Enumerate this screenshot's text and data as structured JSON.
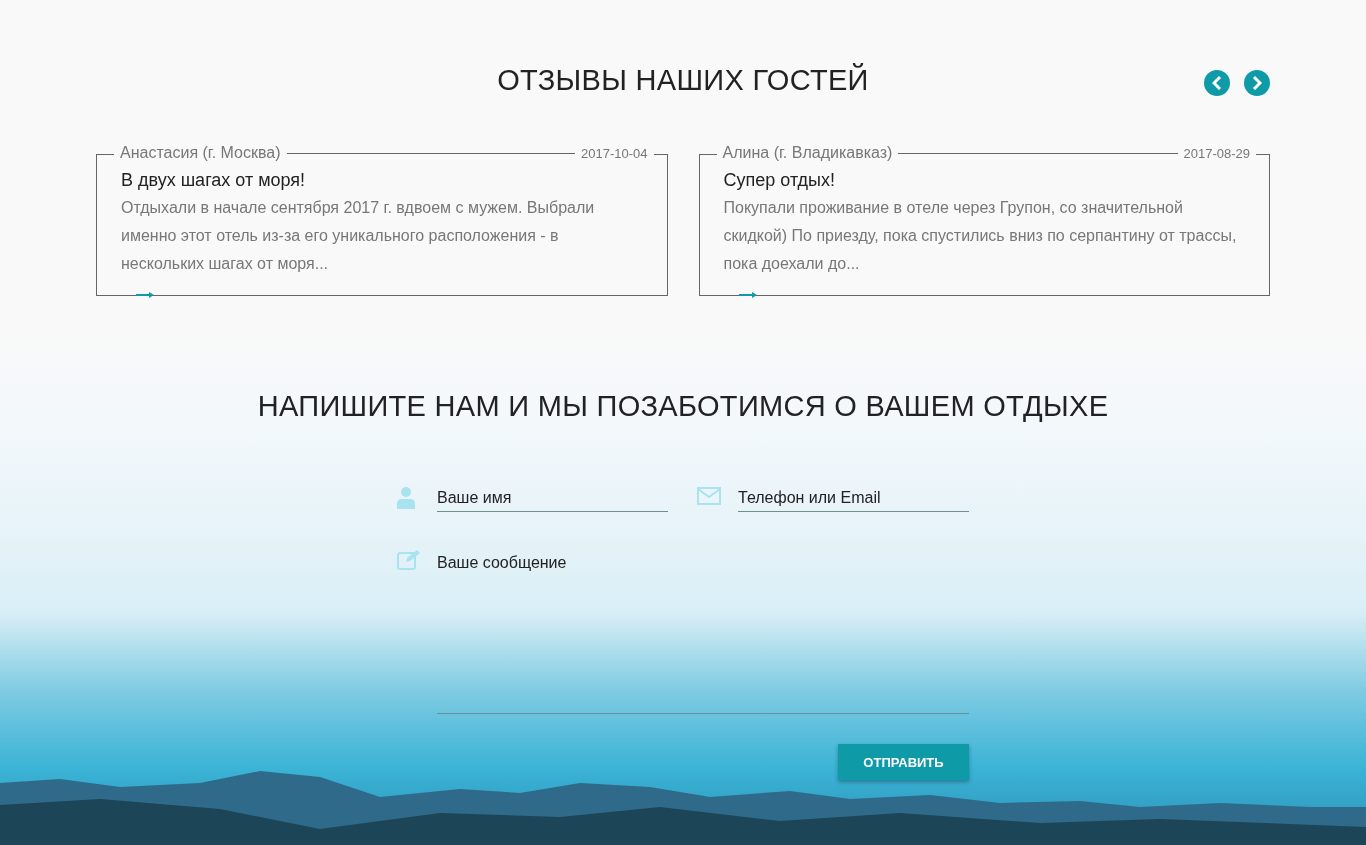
{
  "reviews_section": {
    "title": "ОТЗЫВЫ НАШИХ ГОСТЕЙ",
    "reviews": [
      {
        "author": "Анастасия (г. Москва)",
        "date": "2017-10-04",
        "title": "В двух шагах от моря!",
        "text": "Отдыхали в начале сентября 2017 г. вдвоем с мужем. Выбрали именно этот отель из-за его уникального расположения - в нескольких шагах от моря..."
      },
      {
        "author": "Алина (г. Владикавказ)",
        "date": "2017-08-29",
        "title": "Супер отдых!",
        "text": "Покупали проживание в отеле через Групон, со значительной скидкой) По приезду, пока спустились вниз по серпантину от трассы, пока доехали до..."
      }
    ]
  },
  "contact_section": {
    "title": "НАПИШИТЕ НАМ И МЫ ПОЗАБОТИМСЯ О ВАШЕМ ОТДЫХЕ",
    "fields": [
      {
        "kind": "name",
        "placeholder": "Ваше имя"
      },
      {
        "kind": "contact",
        "placeholder": "Телефон или Email"
      },
      {
        "kind": "message",
        "placeholder": "Ваше сообщение"
      }
    ],
    "submit_button": "ОТПРАВИТЬ"
  }
}
